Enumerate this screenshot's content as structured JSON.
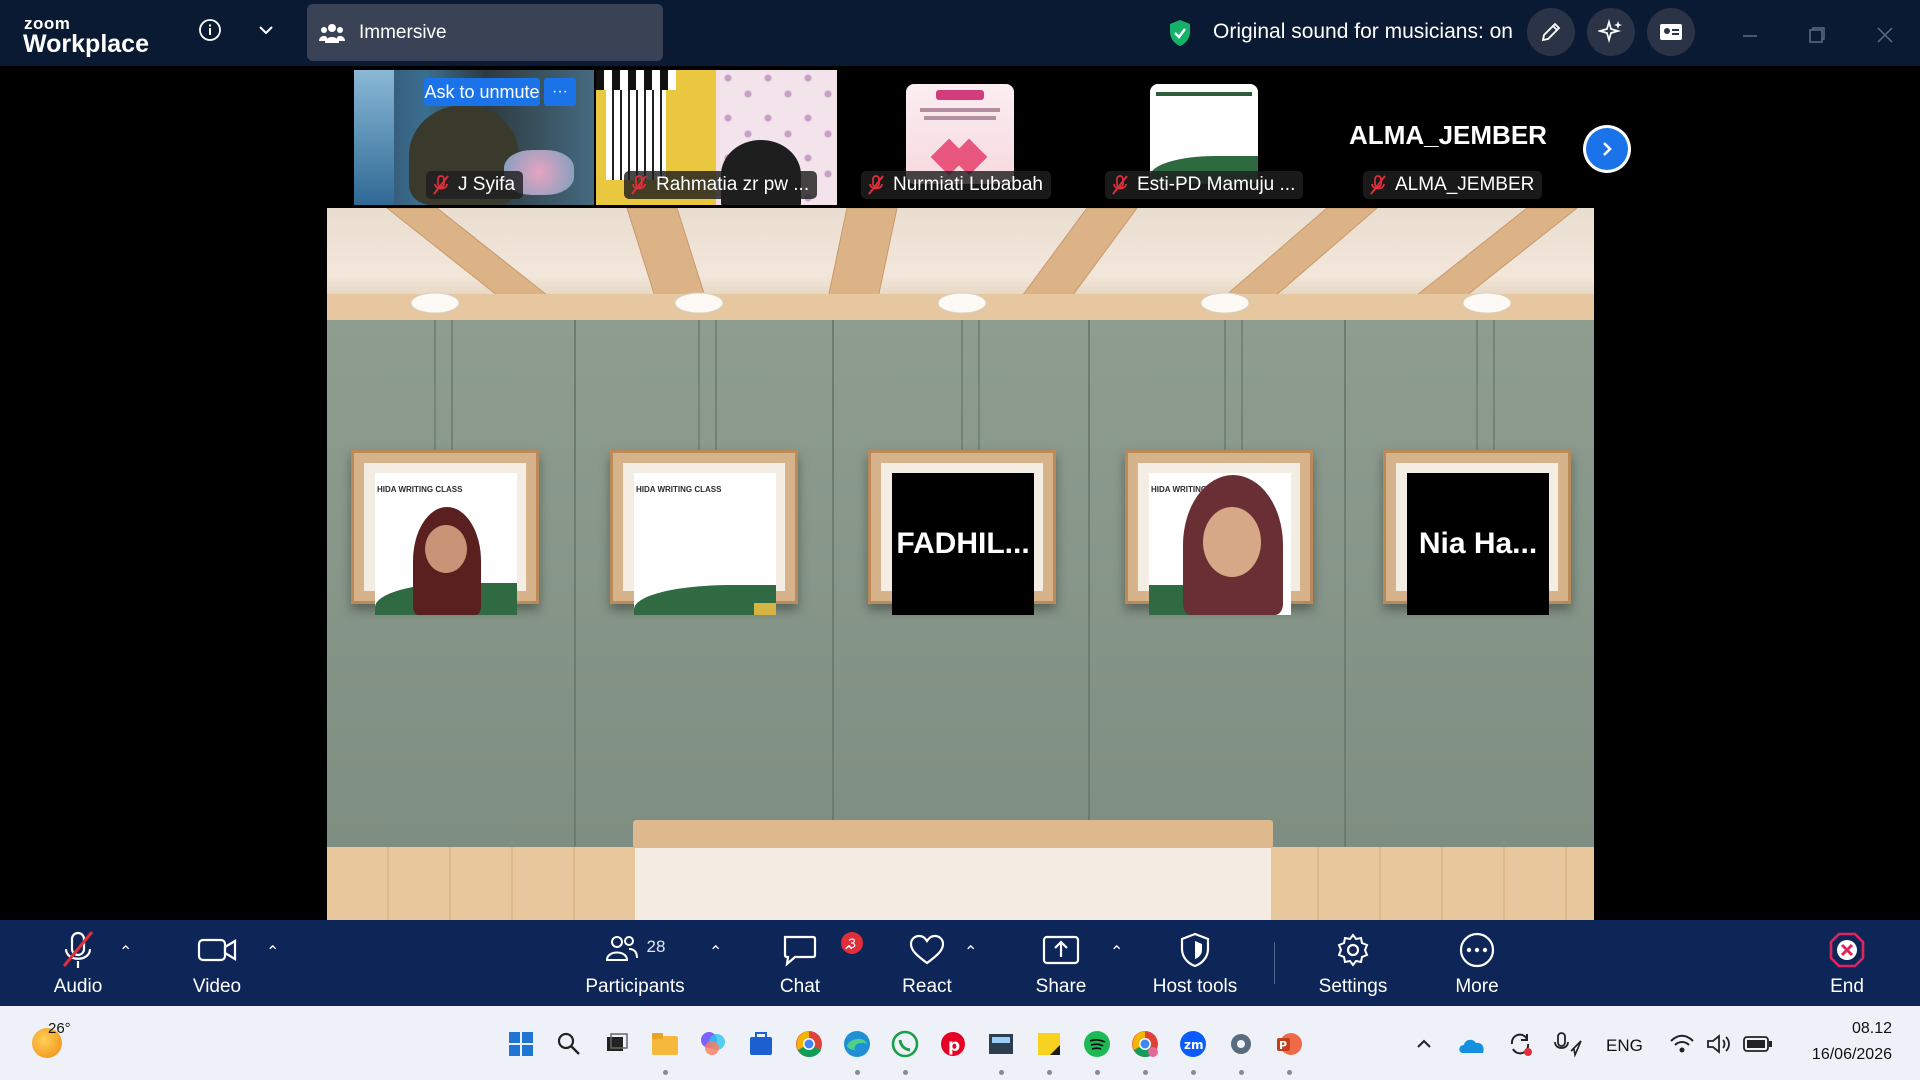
{
  "titlebar": {
    "brand_top": "zoom",
    "brand_bottom": "Workplace",
    "view_label": "Immersive",
    "sound_status": "Original sound for musicians: on"
  },
  "thumbnails": {
    "ask_to_unmute": "Ask to unmute",
    "more_label": "···",
    "participants": [
      {
        "name": "J Syifa"
      },
      {
        "name": "Rahmatia zr pw ..."
      },
      {
        "name": "Nurmiati Lubabah"
      },
      {
        "name": "Esti-PD Mamuju ..."
      },
      {
        "name": "ALMA_JEMBER",
        "display_name": "ALMA_JEMBER"
      }
    ]
  },
  "stage": {
    "slide_caption": "HIDA WRITING CLASS",
    "frames": [
      {
        "type": "video",
        "caption": "HIDA WRITING CLASS"
      },
      {
        "type": "video",
        "caption": "HIDA WRITING CLASS"
      },
      {
        "type": "name",
        "label": "FADHIL..."
      },
      {
        "type": "video",
        "caption": "HIDA WRITING C"
      },
      {
        "type": "name",
        "label": "Nia Ha..."
      }
    ]
  },
  "toolbar": {
    "audio": "Audio",
    "video": "Video",
    "participants": "Participants",
    "participant_count": "28",
    "chat": "Chat",
    "chat_badge": "3",
    "react": "React",
    "share": "Share",
    "host_tools": "Host tools",
    "settings": "Settings",
    "more": "More",
    "end": "End",
    "accent": "#0e2657",
    "end_color": "#e0245e"
  },
  "taskbar": {
    "temperature": "26°",
    "language": "ENG",
    "time": "08.12",
    "date": "16/06/2026"
  }
}
